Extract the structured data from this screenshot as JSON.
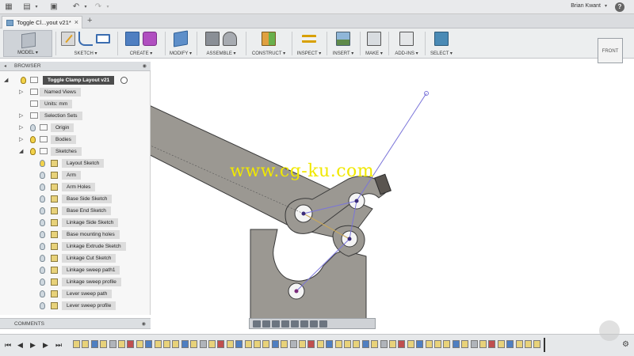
{
  "appbar": {
    "user": "Brian Kwant"
  },
  "tab": {
    "title": "Toggle Cl...yout v21*"
  },
  "ribbon": {
    "groups": [
      {
        "label": "MODEL ▾"
      },
      {
        "label": "SKETCH ▾"
      },
      {
        "label": "CREATE ▾"
      },
      {
        "label": "MODIFY ▾"
      },
      {
        "label": "ASSEMBLE ▾"
      },
      {
        "label": "CONSTRUCT ▾"
      },
      {
        "label": "INSPECT ▾"
      },
      {
        "label": "INSERT ▾"
      },
      {
        "label": "MAKE ▾"
      },
      {
        "label": "ADD-INS ▾"
      },
      {
        "label": "SELECT ▾"
      }
    ]
  },
  "viewcube": {
    "face": "FRONT"
  },
  "browser": {
    "header": "BROWSER",
    "root": "Toggle Clamp Layout v21",
    "items": [
      {
        "label": "Named Views"
      },
      {
        "label": "Units: mm"
      },
      {
        "label": "Selection Sets"
      },
      {
        "label": "Origin"
      },
      {
        "label": "Bodies"
      },
      {
        "label": "Sketches"
      }
    ],
    "sketches": [
      {
        "label": "Layout Sketch"
      },
      {
        "label": "Arm"
      },
      {
        "label": "Arm Holes"
      },
      {
        "label": "Base Side Sketch"
      },
      {
        "label": "Base End Sketch"
      },
      {
        "label": "Linkage Side Sketch"
      },
      {
        "label": "Base mounting holes"
      },
      {
        "label": "Linkage Extrude Sketch"
      },
      {
        "label": "Linkage Cut Sketch"
      },
      {
        "label": "Linkage sweep path1"
      },
      {
        "label": "Linkage sweep profile"
      },
      {
        "label": "Lever sweep path"
      },
      {
        "label": "Lever sweep profile"
      }
    ]
  },
  "comments": {
    "header": "COMMENTS"
  },
  "watermark": "www.cg-ku.com",
  "colors": {
    "part_fill": "#9b9892",
    "part_edge": "#3a3a3a",
    "sketch_line": "#7a74d9",
    "accent_select": "#4a8ab5"
  }
}
